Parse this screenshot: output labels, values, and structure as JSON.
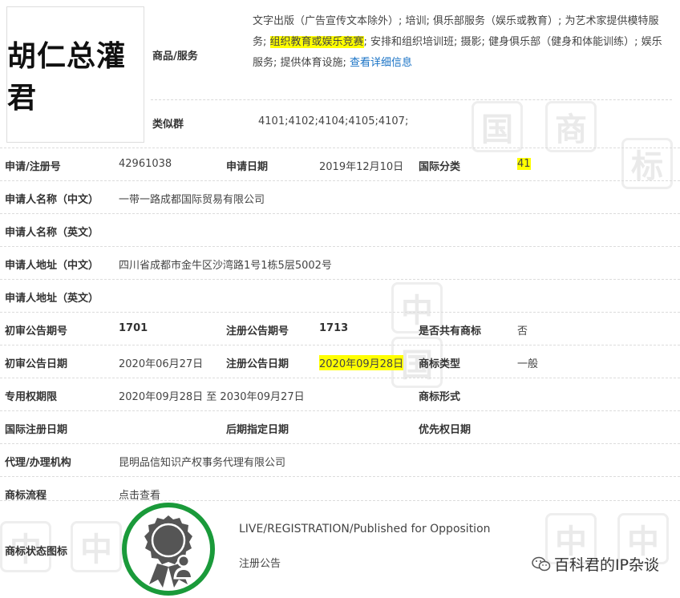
{
  "logo": {
    "text": "胡仁总灌君"
  },
  "goods": {
    "label": "商品/服务",
    "text_before": "文字出版（广告宣传文本除外）; 培训; 俱乐部服务（娱乐或教育）; 为艺术家提供模特服务; ",
    "highlight": "组织教育或娱乐竞赛",
    "text_after": "; 安排和组织培训班; 摄影; 健身俱乐部（健身和体能训练）; 娱乐服务; 提供体育设施; ",
    "detail_link": "查看详细信息"
  },
  "similar": {
    "label": "类似群",
    "value": "4101;4102;4104;4105;4107;"
  },
  "rows": {
    "r1": {
      "l1": "申请/注册号",
      "v1": "42961038",
      "l2": "申请日期",
      "v2": "2019年12月10日",
      "l3": "国际分类",
      "v3": "41"
    },
    "r2": {
      "l1": "申请人名称（中文）",
      "v1": "一带一路成都国际贸易有限公司"
    },
    "r3": {
      "l1": "申请人名称（英文）",
      "v1": ""
    },
    "r4": {
      "l1": "申请人地址（中文）",
      "v1": "四川省成都市金牛区沙湾路1号1栋5层5002号"
    },
    "r5": {
      "l1": "申请人地址（英文）",
      "v1": ""
    },
    "r6": {
      "l1": "初审公告期号",
      "v1": "1701",
      "l2": "注册公告期号",
      "v2": "1713",
      "l3": "是否共有商标",
      "v3": "否"
    },
    "r7": {
      "l1": "初审公告日期",
      "v1": "2020年06月27日",
      "l2": "注册公告日期",
      "v2": "2020年09月28日",
      "l3": "商标类型",
      "v3": "一般"
    },
    "r8": {
      "l1": "专用权期限",
      "v1": "2020年09月28日 至 2030年09月27日",
      "l3": "商标形式",
      "v3": ""
    },
    "r9": {
      "l1": "国际注册日期",
      "v1": "",
      "l2": "后期指定日期",
      "v2": "",
      "l3": "优先权日期",
      "v3": ""
    },
    "r10": {
      "l1": "代理/办理机构",
      "v1": "昆明品信知识产权事务代理有限公司"
    },
    "r11": {
      "l1": "商标流程",
      "v1": "点击查看"
    }
  },
  "status": {
    "label": "商标状态图标",
    "en": "LIVE/REGISTRATION/Published for Opposition",
    "cn": "注册公告",
    "ring_color": "#1a9a3a",
    "badge_color": "#555555"
  },
  "watermark": {
    "wechat_account": "百科君的IP杂谈",
    "glyph_a": "中",
    "glyph_b": "国",
    "glyph_c": "商",
    "glyph_d": "标"
  },
  "colors": {
    "highlight": "#ffff00",
    "link": "#1a73c6"
  }
}
